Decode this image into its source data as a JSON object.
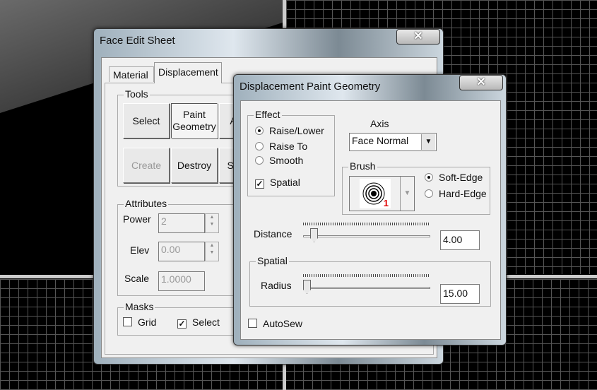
{
  "face_edit_sheet": {
    "title": "Face Edit Sheet",
    "close_label": "✕",
    "tabs": [
      {
        "label": "Material",
        "active": false
      },
      {
        "label": "Displacement",
        "active": true
      }
    ],
    "tools": {
      "label": "Tools",
      "buttons": [
        "Select",
        "Paint\nGeometry",
        "A",
        "Create",
        "Destroy",
        "Su"
      ]
    },
    "attributes": {
      "label": "Attributes",
      "power_label": "Power",
      "power_value": "2",
      "elev_label": "Elev",
      "elev_value": "0.00",
      "scale_label": "Scale",
      "scale_value": "1.0000"
    },
    "masks": {
      "label": "Masks",
      "grid_label": "Grid",
      "grid_checked": false,
      "select_label": "Select",
      "select_checked": true
    }
  },
  "paint_dialog": {
    "title": "Displacement Paint Geometry",
    "close_label": "✕",
    "effect": {
      "label": "Effect",
      "options": [
        "Raise/Lower",
        "Raise To",
        "Smooth"
      ],
      "selected": "Raise/Lower",
      "spatial_label": "Spatial",
      "spatial_checked": true
    },
    "axis": {
      "label": "Axis",
      "value": "Face Normal"
    },
    "brush": {
      "label": "Brush",
      "number": "1",
      "number_color": "#e00000",
      "options": [
        "Soft-Edge",
        "Hard-Edge"
      ],
      "selected": "Soft-Edge"
    },
    "distance": {
      "label": "Distance",
      "value": "4.00"
    },
    "spatial": {
      "label": "Spatial",
      "radius_label": "Radius",
      "radius_value": "15.00"
    },
    "autosew": {
      "label": "AutoSew",
      "checked": false
    }
  }
}
